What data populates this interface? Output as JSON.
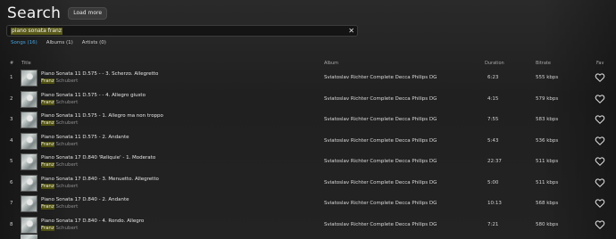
{
  "header": {
    "title": "Search",
    "load_more": "Load more"
  },
  "search": {
    "value": "piano sonata franz",
    "clear_icon": "close-icon"
  },
  "tabs": [
    {
      "label": "Songs (16)",
      "active": true
    },
    {
      "label": "Albums (1)",
      "active": false
    },
    {
      "label": "Artists (0)",
      "active": false
    }
  ],
  "columns": {
    "num": "#",
    "title": "Title",
    "album": "Album",
    "duration": "Duration",
    "bitrate": "Bitrate",
    "fav": "Fav"
  },
  "rows": [
    {
      "num": "1",
      "title": "Piano Sonata 11 D.575 - - 3. Scherzo. Allegretto",
      "artist_hl": "Franz",
      "artist_rest": " Schubert",
      "album": "Sviatoslav Richter Complete Decca Philips DG",
      "duration": "6:23",
      "bitrate": "555 kbps"
    },
    {
      "num": "2",
      "title": "Piano Sonata 11 D.575 - - 4. Allegro giusto",
      "artist_hl": "Franz",
      "artist_rest": " Schubert",
      "album": "Sviatoslav Richter Complete Decca Philips DG",
      "duration": "4:15",
      "bitrate": "579 kbps"
    },
    {
      "num": "3",
      "title": "Piano Sonata 11 D.575 - 1. Allegro ma non troppo",
      "artist_hl": "Franz",
      "artist_rest": " Schubert",
      "album": "Sviatoslav Richter Complete Decca Philips DG",
      "duration": "7:55",
      "bitrate": "583 kbps"
    },
    {
      "num": "4",
      "title": "Piano Sonata 11 D.575 - 2. Andante",
      "artist_hl": "Franz",
      "artist_rest": " Schubert",
      "album": "Sviatoslav Richter Complete Decca Philips DG",
      "duration": "5:43",
      "bitrate": "536 kbps"
    },
    {
      "num": "5",
      "title": "Piano Sonata 17 D.840 'Reliquie' - 1. Moderato",
      "artist_hl": "Franz",
      "artist_rest": " Schubert",
      "album": "Sviatoslav Richter Complete Decca Philips DG",
      "duration": "22:37",
      "bitrate": "511 kbps"
    },
    {
      "num": "6",
      "title": "Piano Sonata 17 D.840 - 3. Menuetto. Allegretto",
      "artist_hl": "Franz",
      "artist_rest": " Schubert",
      "album": "Sviatoslav Richter Complete Decca Philips DG",
      "duration": "5:00",
      "bitrate": "511 kbps"
    },
    {
      "num": "7",
      "title": "Piano Sonata 17 D.840 - 2. Andante",
      "artist_hl": "Franz",
      "artist_rest": " Schubert",
      "album": "Sviatoslav Richter Complete Decca Philips DG",
      "duration": "10:13",
      "bitrate": "568 kbps"
    },
    {
      "num": "8",
      "title": "Piano Sonata 17 D.840 - 4. Rondo. Allegro",
      "artist_hl": "Franz",
      "artist_rest": " Schubert",
      "album": "Sviatoslav Richter Complete Decca Philips DG",
      "duration": "7:21",
      "bitrate": "580 kbps"
    }
  ],
  "icons": {
    "favorite": "heart-outline-icon",
    "album_art": "album-art-thumbnail"
  },
  "colors": {
    "accent": "#4aa3df",
    "highlight": "#4e4e10",
    "background": "#1b1b1b"
  }
}
